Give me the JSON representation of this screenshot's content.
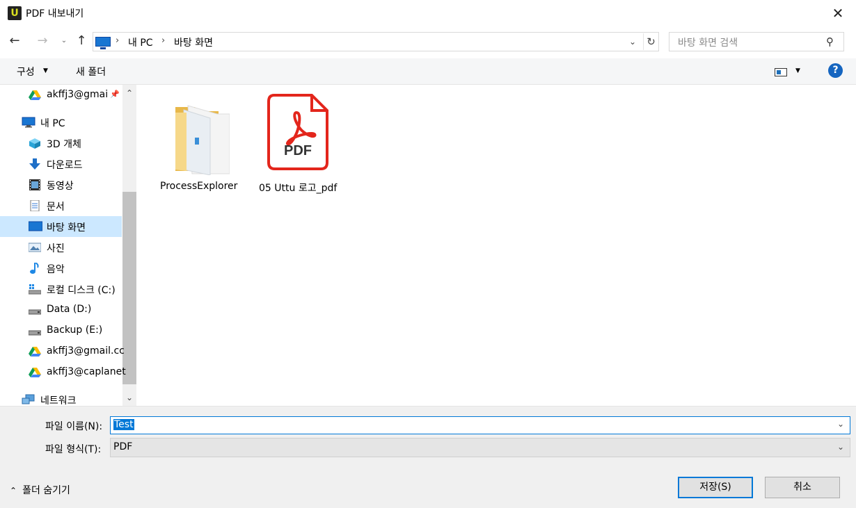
{
  "window": {
    "title": "PDF 내보내기",
    "app_logo_letter": "U",
    "close_symbol": "✕"
  },
  "address": {
    "crumbs": [
      "내 PC",
      "바탕 화면"
    ],
    "separator": "›"
  },
  "search": {
    "placeholder": "바탕 화면 검색"
  },
  "toolbar": {
    "organize_label": "구성",
    "new_folder_label": "새 폴더",
    "help_symbol": "?"
  },
  "nav": {
    "items": [
      {
        "label": "akffj3@gmai",
        "icon": "google-drive-icon"
      },
      {
        "label": "내 PC",
        "icon": "pc-icon"
      },
      {
        "label": "3D 개체",
        "icon": "3d-objects-icon"
      },
      {
        "label": "다운로드",
        "icon": "download-icon"
      },
      {
        "label": "동영상",
        "icon": "video-icon"
      },
      {
        "label": "문서",
        "icon": "document-icon"
      },
      {
        "label": "바탕 화면",
        "icon": "desktop-icon",
        "selected": true
      },
      {
        "label": "사진",
        "icon": "pictures-icon"
      },
      {
        "label": "음악",
        "icon": "music-icon"
      },
      {
        "label": "로컬 디스크 (C:)",
        "icon": "windows-drive-icon"
      },
      {
        "label": "Data (D:)",
        "icon": "drive-icon"
      },
      {
        "label": "Backup (E:)",
        "icon": "drive-icon"
      },
      {
        "label": "akffj3@gmail.cc",
        "icon": "google-drive-icon"
      },
      {
        "label": "akffj3@caplanet",
        "icon": "google-drive-icon"
      },
      {
        "label": "네트워크",
        "icon": "network-icon"
      }
    ]
  },
  "files": [
    {
      "name": "ProcessExplorer",
      "type": "folder"
    },
    {
      "name": "05 Uttu 로고_pdf",
      "type": "pdf",
      "badge": "PDF"
    }
  ],
  "bottom": {
    "filename_label": "파일 이름(N):",
    "filename_value": "Test",
    "filetype_label": "파일 형식(T):",
    "filetype_value": "PDF",
    "hide_folders_label": "폴더 숨기기",
    "save_label": "저장(S)",
    "cancel_label": "취소"
  },
  "colors": {
    "accent": "#0078d7",
    "selection": "#cce8ff",
    "pdf_red": "#e3261c",
    "folder_yellow": "#f5d27a"
  }
}
